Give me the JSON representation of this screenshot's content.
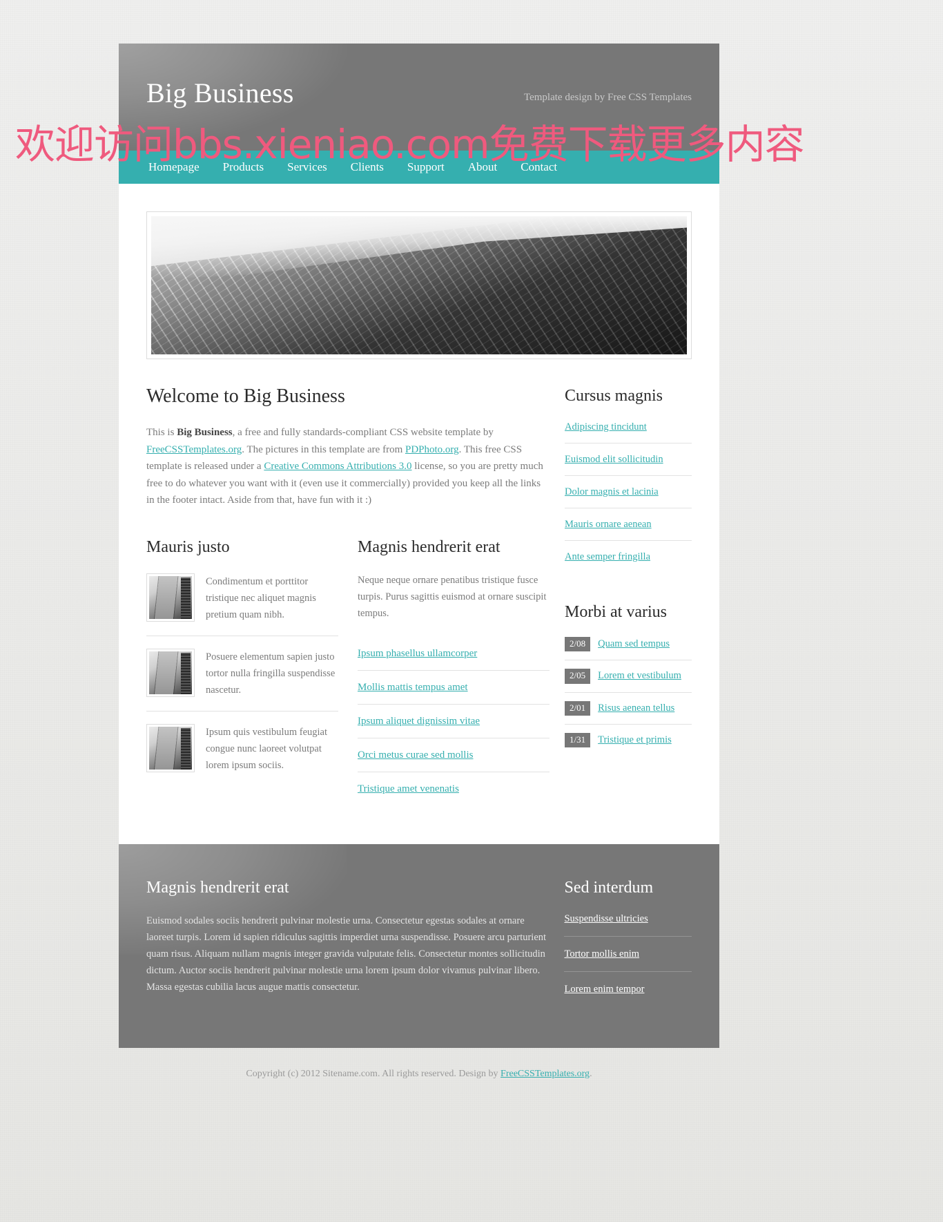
{
  "site": {
    "title": "Big Business",
    "header_credit": "Template design by Free CSS Templates"
  },
  "menu": {
    "items": [
      {
        "label": "Homepage"
      },
      {
        "label": "Products"
      },
      {
        "label": "Services"
      },
      {
        "label": "Clients"
      },
      {
        "label": "Support"
      },
      {
        "label": "About"
      },
      {
        "label": "Contact"
      }
    ]
  },
  "banner": {
    "image_name": "skyscraper-photo"
  },
  "welcome": {
    "heading": "Welcome to Big Business",
    "p_part1": "This is ",
    "p_bold": "Big Business",
    "p_part2": ", a free and fully standards-compliant CSS website template by ",
    "link1": "FreeCSSTemplates.org",
    "p_part3": ". The pictures in this template are from ",
    "link2": "PDPhoto.org",
    "p_part4": ". This free CSS template is released under a ",
    "link3": "Creative Commons Attributions 3.0",
    "p_part5": " license, so you are pretty much free to do whatever you want with it (even use it commercially) provided you keep all the links in the footer intact. Aside from that, have fun with it :)"
  },
  "mauris": {
    "heading": "Mauris justo",
    "items": [
      {
        "text": "Condimentum et porttitor tristique nec aliquet magnis pretium quam nibh."
      },
      {
        "text": "Posuere elementum sapien justo tortor nulla fringilla suspendisse nascetur."
      },
      {
        "text": "Ipsum quis vestibulum feugiat congue nunc laoreet volutpat lorem ipsum sociis."
      }
    ]
  },
  "magnis": {
    "heading": "Magnis hendrerit erat",
    "intro": "Neque neque ornare penatibus tristique fusce turpis. Purus sagittis euismod at ornare suscipit tempus.",
    "links": [
      {
        "label": "Ipsum phasellus ullamcorper"
      },
      {
        "label": "Mollis mattis tempus amet"
      },
      {
        "label": "Ipsum aliquet dignissim vitae"
      },
      {
        "label": "Orci metus curae sed mollis"
      },
      {
        "label": "Tristique amet venenatis"
      }
    ]
  },
  "sidebar": {
    "cursus": {
      "heading": "Cursus magnis",
      "links": [
        {
          "label": "Adipiscing tincidunt"
        },
        {
          "label": "Euismod elit sollicitudin"
        },
        {
          "label": "Dolor magnis et lacinia"
        },
        {
          "label": "Mauris ornare aenean"
        },
        {
          "label": "Ante semper fringilla"
        }
      ]
    },
    "morbi": {
      "heading": "Morbi at varius",
      "items": [
        {
          "date": "2/08",
          "label": "Quam sed tempus"
        },
        {
          "date": "2/05",
          "label": "Lorem et vestibulum"
        },
        {
          "date": "2/01",
          "label": "Risus aenean tellus"
        },
        {
          "date": "1/31",
          "label": "Tristique et primis"
        }
      ]
    }
  },
  "footer": {
    "heading": "Magnis hendrerit erat",
    "text": "Euismod sodales sociis hendrerit pulvinar molestie urna. Consectetur egestas sodales at ornare laoreet turpis. Lorem id sapien ridiculus sagittis imperdiet urna suspendisse. Posuere arcu parturient quam risus. Aliquam nullam magnis integer gravida vulputate felis. Consectetur montes sollicitudin dictum. Auctor sociis hendrerit pulvinar molestie urna lorem ipsum dolor vivamus pulvinar libero. Massa egestas cubilia lacus augue mattis consectetur.",
    "side_heading": "Sed interdum",
    "side_links": [
      {
        "label": "Suspendisse ultricies"
      },
      {
        "label": "Tortor mollis enim"
      },
      {
        "label": "Lorem enim tempor"
      }
    ]
  },
  "legal": {
    "text_part1": "Copyright (c) 2012 Sitename.com. All rights reserved. Design by ",
    "link": "FreeCSSTemplates.org",
    "text_part2": "."
  },
  "watermark": {
    "text": "欢迎访问bbs.xieniao.com免费下载更多内容"
  },
  "colors": {
    "accent_teal": "#35afaf",
    "header_gray": "#777777",
    "body_text": "#7b7b7b",
    "heading_dark": "#2b2b2b",
    "watermark_pink": "#ef5a7e"
  }
}
